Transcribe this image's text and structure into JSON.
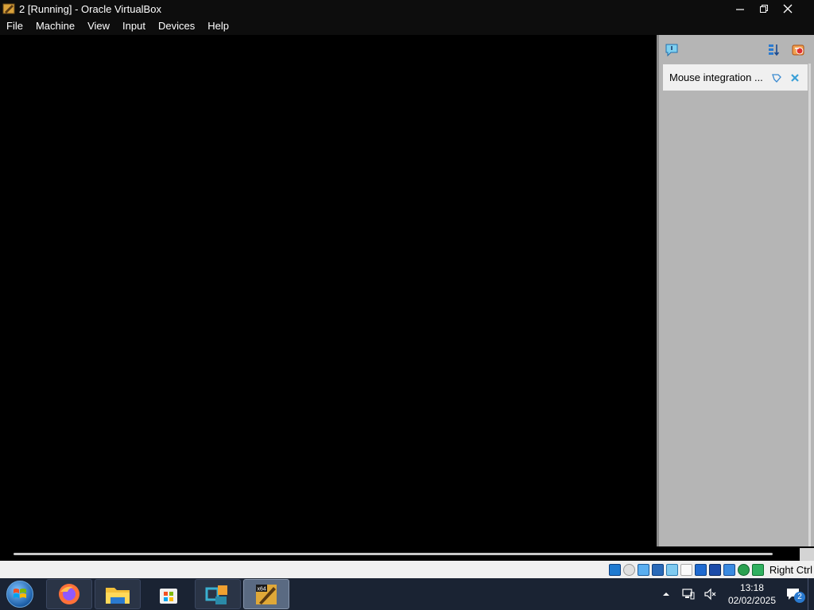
{
  "window": {
    "title": "2 [Running] - Oracle VirtualBox",
    "app_icon": "virtualbox-icon",
    "controls": {
      "minimize": "minimize-icon",
      "restore": "restore-icon",
      "close": "close-icon"
    }
  },
  "menubar": {
    "items": [
      {
        "label": "File"
      },
      {
        "label": "Machine"
      },
      {
        "label": "View"
      },
      {
        "label": "Input"
      },
      {
        "label": "Devices"
      },
      {
        "label": "Help"
      }
    ]
  },
  "notification_center": {
    "top_icons": [
      "notification-icon",
      "sort-order-icon",
      "keep-finished-icon"
    ],
    "messages": [
      {
        "text": "Mouse integration ...",
        "icons": [
          "help-icon",
          "close-icon"
        ]
      }
    ]
  },
  "statusbar": {
    "icons": [
      "hard-disk-icon",
      "optical-drive-icon",
      "audio-icon",
      "network-icon",
      "usb-icon",
      "shared-folders-icon",
      "display-icon",
      "recording-icon",
      "cpu-icon",
      "mouse-integration-icon",
      "keyboard-icon"
    ],
    "host_key": "Right Ctrl"
  },
  "taskbar": {
    "apps": [
      {
        "name": "firefox-icon"
      },
      {
        "name": "file-explorer-icon"
      },
      {
        "name": "store-icon"
      },
      {
        "name": "virtualbox-manager-icon"
      },
      {
        "name": "virtualbox-vm-icon",
        "badge": "x64"
      }
    ],
    "tray": {
      "time": "13:18",
      "date": "02/02/2025",
      "notification_count": "2"
    }
  },
  "colors": {
    "titlebar_bg": "#0d0d0d",
    "panel_bg": "#b5b5b5",
    "statusbar_bg": "#f0f0f0",
    "taskbar_bg": "#1a2333"
  }
}
